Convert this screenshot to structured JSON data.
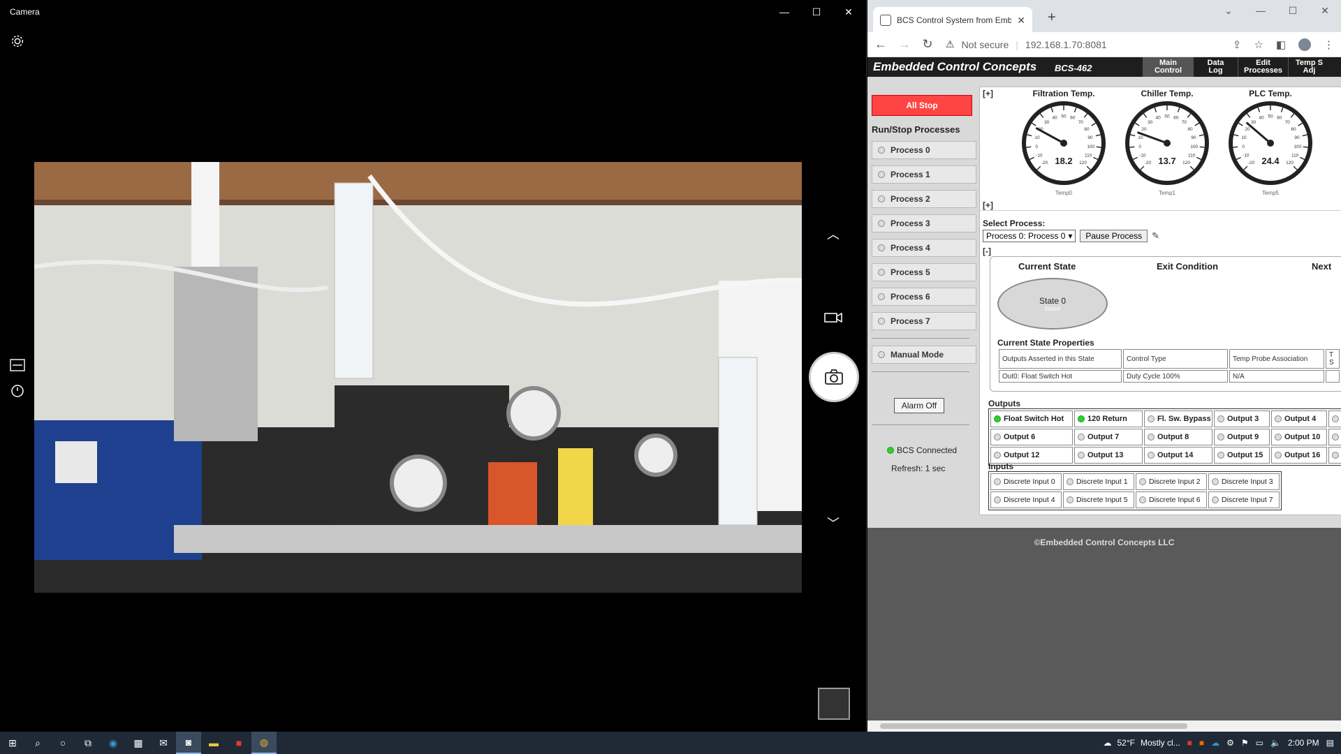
{
  "camera": {
    "title": "Camera",
    "controls": {
      "minimize": "—",
      "maximize": "☐",
      "close": "✕"
    }
  },
  "browser": {
    "tab_title": "BCS Control System from Embed",
    "new_tab": "+",
    "address": {
      "not_secure": "Not secure",
      "url": "192.168.1.70:8081"
    }
  },
  "bcs": {
    "brand": "Embedded Control Concepts",
    "model": "BCS-462",
    "nav": [
      "Main Control",
      "Data Log",
      "Edit Processes",
      "Temp S Adj"
    ],
    "all_stop": "All Stop",
    "run_stop_title": "Run/Stop Processes",
    "processes": [
      "Process 0",
      "Process 1",
      "Process 2",
      "Process 3",
      "Process 4",
      "Process 5",
      "Process 6",
      "Process 7"
    ],
    "manual_mode": "Manual Mode",
    "alarm_off": "Alarm Off",
    "connected": "BCS Connected",
    "refresh": "Refresh: 1 sec",
    "expand": "[+]",
    "collapse": "[-]",
    "gauges": [
      {
        "title": "Filtration Temp.",
        "value": "18.2",
        "sub": "Temp0",
        "reading": 18.2
      },
      {
        "title": "Chiller Temp.",
        "value": "13.7",
        "sub": "Temp1",
        "reading": 13.7
      },
      {
        "title": "PLC Temp.",
        "value": "24.4",
        "sub": "Temp5",
        "reading": 24.4
      }
    ],
    "gauge_scale": {
      "min": -20,
      "max": 120,
      "ticks": [
        "-20",
        "-10",
        "0",
        "10",
        "20",
        "30",
        "40",
        "50",
        "60",
        "70",
        "80",
        "90",
        "100",
        "110",
        "120"
      ]
    },
    "select_process_label": "Select Process:",
    "select_value": "Process 0: Process 0",
    "pause_label": "Pause Process",
    "current_state_h": "Current State",
    "exit_condition_h": "Exit Condition",
    "next_h": "Next",
    "state_name": "State 0",
    "state_sub": "State0",
    "props_title": "Current State Properties",
    "props_headers": [
      "Outputs Asserted in this State",
      "Control Type",
      "Temp Probe Association",
      "T S"
    ],
    "props_values": [
      "Out0: Float Switch Hot",
      "Duty Cycle 100%",
      "N/A",
      ""
    ],
    "outputs_title": "Outputs",
    "outputs": [
      {
        "label": "Float Switch Hot",
        "on": true
      },
      {
        "label": "120 Return",
        "on": true
      },
      {
        "label": "Fl. Sw. Bypass",
        "on": false
      },
      {
        "label": "Output 3",
        "on": false
      },
      {
        "label": "Output 4",
        "on": false
      },
      {
        "label": "O",
        "on": false
      },
      {
        "label": "Output 6",
        "on": false
      },
      {
        "label": "Output 7",
        "on": false
      },
      {
        "label": "Output 8",
        "on": false
      },
      {
        "label": "Output 9",
        "on": false
      },
      {
        "label": "Output 10",
        "on": false
      },
      {
        "label": "O",
        "on": false
      },
      {
        "label": "Output 12",
        "on": false
      },
      {
        "label": "Output 13",
        "on": false
      },
      {
        "label": "Output 14",
        "on": false
      },
      {
        "label": "Output 15",
        "on": false
      },
      {
        "label": "Output 16",
        "on": false
      },
      {
        "label": "O",
        "on": false
      }
    ],
    "inputs_title": "Inputs",
    "inputs": [
      "Discrete Input 0",
      "Discrete Input 1",
      "Discrete Input 2",
      "Discrete Input 3",
      "Discrete Input 4",
      "Discrete Input 5",
      "Discrete Input 6",
      "Discrete Input 7"
    ],
    "copyright": "©Embedded Control Concepts LLC"
  },
  "taskbar": {
    "weather": "52°F",
    "weather_text": "Mostly cl...",
    "time": "2:00 PM"
  }
}
